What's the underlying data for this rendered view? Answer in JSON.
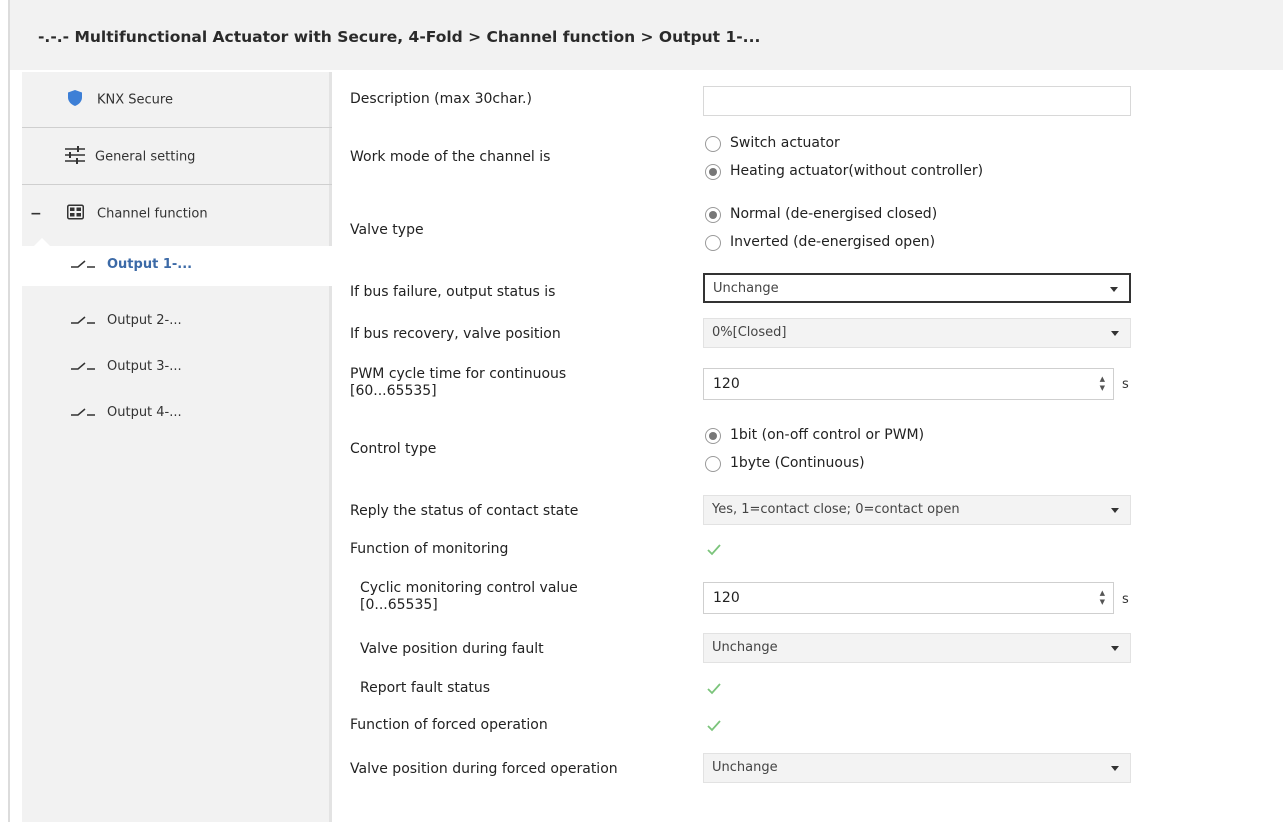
{
  "header": {
    "title": "-.-.- Multifunctional Actuator with Secure, 4-Fold > Channel function > Output 1-..."
  },
  "sidebar": {
    "items": [
      {
        "label": "KNX Secure",
        "icon": "shield-icon"
      },
      {
        "label": "General setting",
        "icon": "sliders-icon"
      },
      {
        "label": "Channel function",
        "icon": "grid-icon",
        "expander": "−"
      }
    ],
    "subitems": [
      {
        "label": "Output 1-...",
        "icon": "switch-icon",
        "active": true
      },
      {
        "label": "Output 2-...",
        "icon": "switch-icon"
      },
      {
        "label": "Output 3-...",
        "icon": "switch-icon"
      },
      {
        "label": "Output 4-...",
        "icon": "switch-icon"
      }
    ]
  },
  "main": {
    "description": {
      "label": "Description (max 30char.)",
      "value": ""
    },
    "work_mode": {
      "label": "Work mode of the channel is",
      "options": [
        "Switch actuator",
        "Heating actuator(without controller)"
      ],
      "selected": 1
    },
    "valve_type": {
      "label": "Valve type",
      "options": [
        "Normal (de-energised closed)",
        "Inverted (de-energised open)"
      ],
      "selected": 0
    },
    "bus_failure": {
      "label": "If bus failure, output status is",
      "value": "Unchange"
    },
    "bus_recovery": {
      "label": "If bus recovery, valve position",
      "value": "0%[Closed]"
    },
    "pwm_cycle": {
      "label_line1": "PWM cycle time for continuous",
      "label_line2": "[60...65535]",
      "value": "120",
      "unit": "s"
    },
    "control_type": {
      "label": "Control type",
      "options": [
        "1bit (on-off control or PWM)",
        "1byte (Continuous)"
      ],
      "selected": 0
    },
    "reply_status": {
      "label": "Reply the status of contact state",
      "value": "Yes, 1=contact close; 0=contact open"
    },
    "monitoring": {
      "label": "Function of monitoring",
      "checked": true
    },
    "cyclic_monitoring": {
      "label_line1": "Cyclic monitoring control value",
      "label_line2": "[0...65535]",
      "value": "120",
      "unit": "s"
    },
    "fault_position": {
      "label": "Valve position during fault",
      "value": "Unchange"
    },
    "report_fault": {
      "label": "Report fault status",
      "checked": true
    },
    "forced_operation": {
      "label": "Function of forced operation",
      "checked": true
    },
    "forced_position": {
      "label": "Valve position during forced operation",
      "value": "Unchange"
    }
  },
  "colors": {
    "active_nav": "#3c6aa7",
    "check": "#7bc47b",
    "shield": "#3d7fd6"
  }
}
